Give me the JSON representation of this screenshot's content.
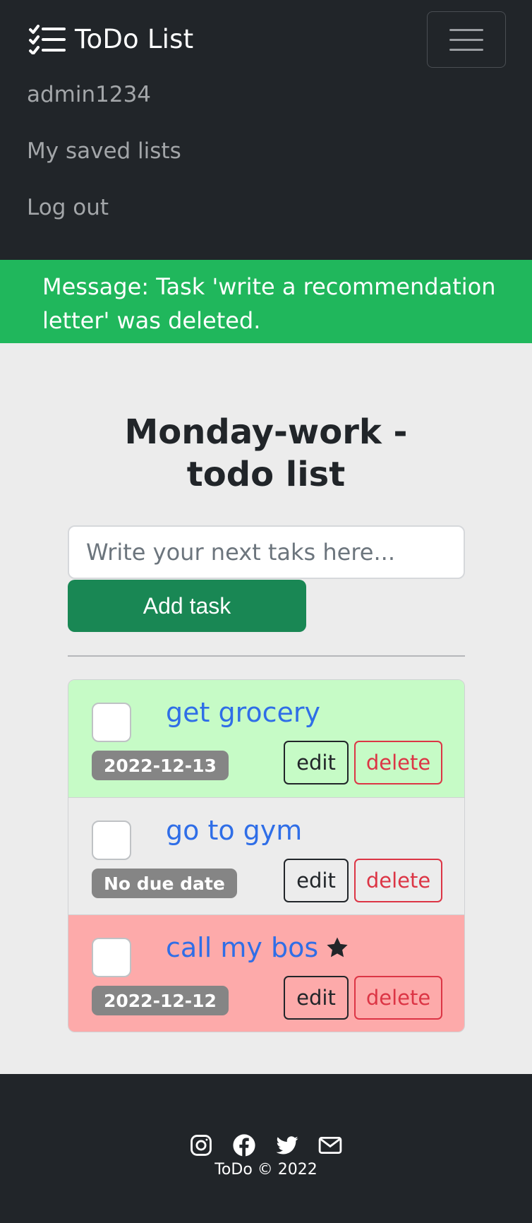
{
  "navbar": {
    "brand": "ToDo List",
    "brand_icon": "checklist-icon",
    "toggler_icon": "hamburger-menu-icon",
    "links": [
      "admin1234",
      "My saved lists",
      "Log out"
    ]
  },
  "alert": {
    "message": "Message: Task 'write a recommendation letter' was deleted."
  },
  "main": {
    "title_line1": "Monday-work -",
    "title_line2": "todo list",
    "input_placeholder": "Write your next taks here...",
    "add_button": "Add task"
  },
  "tasks": [
    {
      "name": "get grocery",
      "due": "2022-12-13",
      "edit": "edit",
      "delete": "delete",
      "color": "#c6fbc6",
      "starred": false,
      "checked": false
    },
    {
      "name": "go to gym",
      "due": "No due date",
      "edit": "edit",
      "delete": "delete",
      "color": "#ececec",
      "starred": false,
      "checked": false
    },
    {
      "name": "call my bos",
      "due": "2022-12-12",
      "edit": "edit",
      "delete": "delete",
      "color": "#fdaaaa",
      "starred": true,
      "checked": false
    }
  ],
  "footer": {
    "icons": [
      "instagram-icon",
      "facebook-icon",
      "twitter-icon",
      "envelope-icon"
    ],
    "copyright": "ToDo © 2022"
  },
  "colors": {
    "navbar_bg": "#212529",
    "alert_bg": "#20b75c",
    "add_button_bg": "#198754",
    "link_blue": "#2f6ee7",
    "delete_red": "#dc3545"
  }
}
